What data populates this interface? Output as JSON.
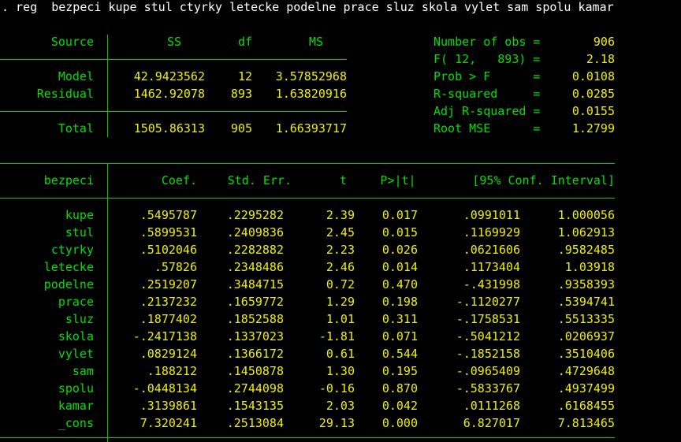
{
  "colors": {
    "background": "#000000",
    "command": "#ffffff",
    "labels": "#00e000",
    "values": "#f0f000",
    "rules": "#00c800"
  },
  "command": ". reg  bezpeci kupe stul ctyrky letecke podelne prace sluz skola vylet sam spolu kamar",
  "anova": {
    "headers": {
      "source": "Source",
      "ss": "SS",
      "df": "df",
      "ms": "MS"
    },
    "rows": [
      {
        "source": "Model",
        "ss": "42.9423562",
        "df": "12",
        "ms": "3.57852968"
      },
      {
        "source": "Residual",
        "ss": "1462.92078",
        "df": "893",
        "ms": "1.63820916"
      }
    ],
    "total": {
      "source": "Total",
      "ss": "1505.86313",
      "df": "905",
      "ms": "1.66393717"
    }
  },
  "stats": [
    {
      "label": "Number of obs =",
      "value": "906"
    },
    {
      "label": "F( 12,   893) =",
      "value": "2.18"
    },
    {
      "label": "Prob > F      =",
      "value": "0.0108"
    },
    {
      "label": "R-squared     =",
      "value": "0.0285"
    },
    {
      "label": "Adj R-squared =",
      "value": "0.0155"
    },
    {
      "label": "Root MSE      =",
      "value": "1.2799"
    }
  ],
  "coef_table": {
    "headers": {
      "var": "bezpeci",
      "coef": "Coef.",
      "se": "Std. Err.",
      "t": "t",
      "p": "P>|t|",
      "ci": "[95% Conf. Interval]"
    },
    "rows": [
      {
        "var": "kupe",
        "coef": ".5495787",
        "se": ".2295282",
        "t": "2.39",
        "p": "0.017",
        "lo": ".0991011",
        "hi": "1.000056"
      },
      {
        "var": "stul",
        "coef": ".5899531",
        "se": ".2409836",
        "t": "2.45",
        "p": "0.015",
        "lo": ".1169929",
        "hi": "1.062913"
      },
      {
        "var": "ctyrky",
        "coef": ".5102046",
        "se": ".2282882",
        "t": "2.23",
        "p": "0.026",
        "lo": ".0621606",
        "hi": ".9582485"
      },
      {
        "var": "letecke",
        "coef": ".57826",
        "se": ".2348486",
        "t": "2.46",
        "p": "0.014",
        "lo": ".1173404",
        "hi": "1.03918"
      },
      {
        "var": "podelne",
        "coef": ".2519207",
        "se": ".3484715",
        "t": "0.72",
        "p": "0.470",
        "lo": "-.431998",
        "hi": ".9358393"
      },
      {
        "var": "prace",
        "coef": ".2137232",
        "se": ".1659772",
        "t": "1.29",
        "p": "0.198",
        "lo": "-.1120277",
        "hi": ".5394741"
      },
      {
        "var": "sluz",
        "coef": ".1877402",
        "se": ".1852588",
        "t": "1.01",
        "p": "0.311",
        "lo": "-.1758531",
        "hi": ".5513335"
      },
      {
        "var": "skola",
        "coef": "-.2417138",
        "se": ".1337023",
        "t": "-1.81",
        "p": "0.071",
        "lo": "-.5041212",
        "hi": ".0206937"
      },
      {
        "var": "vylet",
        "coef": ".0829124",
        "se": ".1366172",
        "t": "0.61",
        "p": "0.544",
        "lo": "-.1852158",
        "hi": ".3510406"
      },
      {
        "var": "sam",
        "coef": ".188212",
        "se": ".1450878",
        "t": "1.30",
        "p": "0.195",
        "lo": "-.0965409",
        "hi": ".4729648"
      },
      {
        "var": "spolu",
        "coef": "-.0448134",
        "se": ".2744098",
        "t": "-0.16",
        "p": "0.870",
        "lo": "-.5833767",
        "hi": ".4937499"
      },
      {
        "var": "kamar",
        "coef": ".3139861",
        "se": ".1543135",
        "t": "2.03",
        "p": "0.042",
        "lo": ".0111268",
        "hi": ".6168455"
      },
      {
        "var": "_cons",
        "coef": "7.320241",
        "se": ".2513084",
        "t": "29.13",
        "p": "0.000",
        "lo": "6.827017",
        "hi": "7.813465"
      }
    ]
  }
}
